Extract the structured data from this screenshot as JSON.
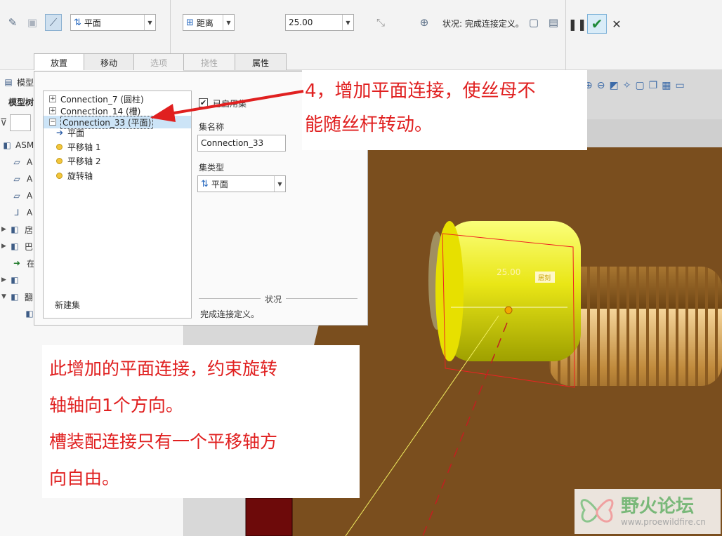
{
  "ribbon": {
    "type_combo": "平面",
    "offset_type_combo": "距离",
    "offset_value": "25.00",
    "status_label": "状况: 完成连接定义。"
  },
  "tabs": [
    {
      "label": "放置",
      "state": "selected"
    },
    {
      "label": "移动",
      "state": "normal"
    },
    {
      "label": "选项",
      "state": "disabled"
    },
    {
      "label": "挠性",
      "state": "disabled"
    },
    {
      "label": "属性",
      "state": "normal"
    }
  ],
  "tree": {
    "title_partial": "模型树",
    "subtitle_partial": "模型树",
    "root_label": "ASM",
    "rows": [
      {
        "icon": "datum-plane-icon",
        "label": "A"
      },
      {
        "icon": "datum-plane-icon",
        "label": "A"
      },
      {
        "icon": "datum-plane-icon",
        "label": "A"
      },
      {
        "icon": "coordinate-system-icon",
        "label": "A"
      },
      {
        "icon": "part-icon",
        "label": "扂"
      },
      {
        "icon": "part-icon",
        "label": "巴"
      },
      {
        "icon": "insert-arrow-icon",
        "label": "在"
      },
      {
        "icon": "part-icon",
        "label": ""
      },
      {
        "icon": "part-icon",
        "label": "翻"
      }
    ]
  },
  "panel": {
    "sets": [
      {
        "label": "Connection_7 (圆柱)",
        "expanded": false
      },
      {
        "label": "Connection_14 (槽)",
        "expanded": false
      },
      {
        "label": "Connection_33 (平面)",
        "expanded": true
      }
    ],
    "children": [
      {
        "label": "平面",
        "icon": "arrow-right-icon"
      },
      {
        "label": "平移轴 1",
        "icon": "yellow-dot-icon"
      },
      {
        "label": "平移轴 2",
        "icon": "yellow-dot-icon"
      },
      {
        "label": "旋转轴",
        "icon": "yellow-dot-icon"
      }
    ],
    "new_set_label": "新建集",
    "enabled_label": "已启用集",
    "set_name_label": "集名称",
    "set_name_value": "Connection_33",
    "set_type_label": "集类型",
    "set_type_value": "平面",
    "status_label": "状况",
    "status_text": "完成连接定义。"
  },
  "viewport": {
    "dimension_value": "25.00",
    "dimension_tag": "居刻"
  },
  "callouts": {
    "top_line1": "4，增加平面连接，使丝母不",
    "top_line2": "能随丝杆转动。",
    "bottom_line1": "此增加的平面连接，约束旋转",
    "bottom_line2": "轴轴向1个方向。",
    "bottom_line3": "槽装配连接只有一个平移轴方",
    "bottom_line4": "向自由。"
  },
  "watermark": {
    "title": "野火论坛",
    "url": "www.proewildfire.cn"
  }
}
